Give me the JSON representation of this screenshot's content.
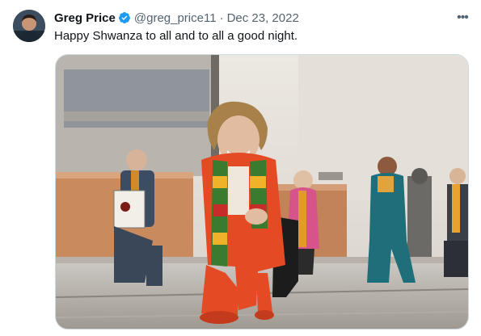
{
  "tweet": {
    "display_name": "Greg Price",
    "handle": "@greg_price11",
    "separator": "·",
    "date": "Dec 23, 2022",
    "text": "Happy Shwanza to all and to all a good night.",
    "more_label": "•••",
    "verified_icon": "verified-badge-icon",
    "more_icon": "more-options-icon"
  },
  "colors": {
    "text": "#0f1419",
    "secondary": "#536471",
    "verified": "#1d9bf0",
    "border": "#cfd9de"
  }
}
